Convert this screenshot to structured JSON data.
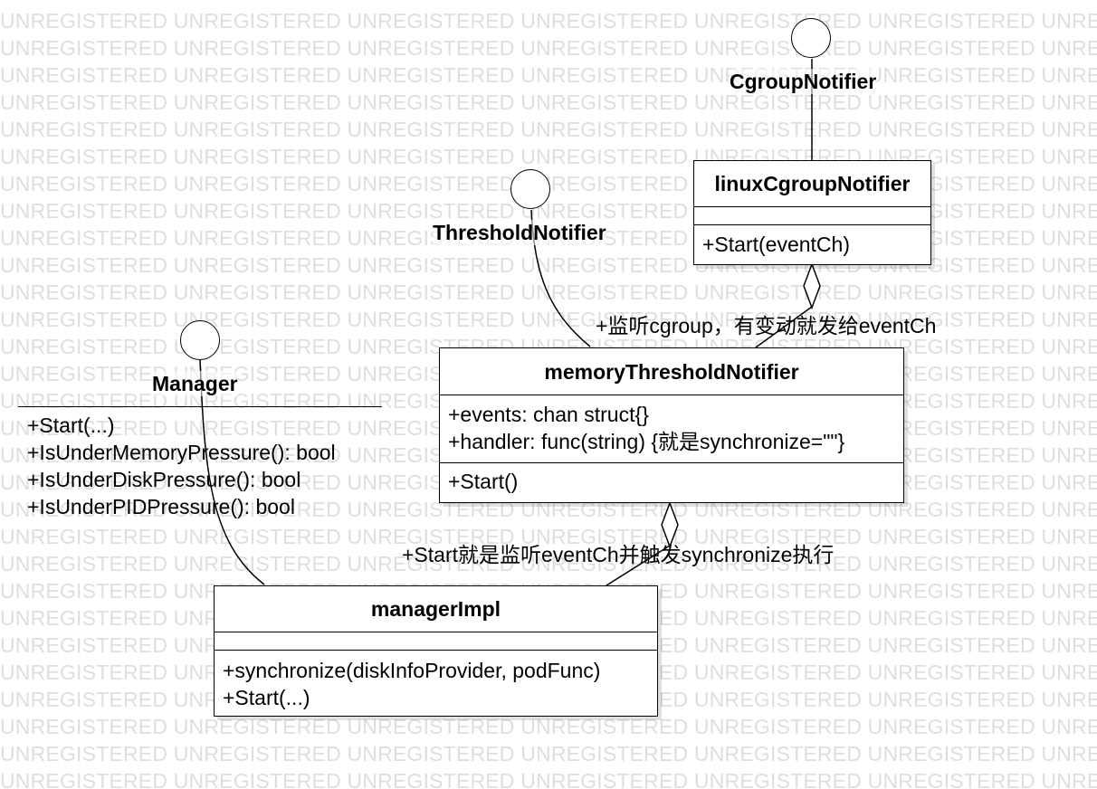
{
  "watermark": {
    "text": "UNREGISTERED",
    "rows": 29
  },
  "interfaces": {
    "manager": {
      "name": "Manager",
      "operations": [
        "+Start(...)",
        "+IsUnderMemoryPressure(): bool",
        "+IsUnderDiskPressure(): bool",
        "+IsUnderPIDPressure(): bool"
      ]
    },
    "threshold_notifier": {
      "name": "ThresholdNotifier"
    },
    "cgroup_notifier": {
      "name": "CgroupNotifier"
    }
  },
  "classes": {
    "linux_cgroup_notifier": {
      "name": "linuxCgroupNotifier",
      "attributes": [],
      "operations": [
        "+Start(eventCh)"
      ]
    },
    "memory_threshold_notifier": {
      "name": "memoryThresholdNotifier",
      "attributes": [
        "+events: chan struct{}",
        "+handler: func(string) {就是synchronize=\"\"}"
      ],
      "operations": [
        "+Start()"
      ]
    },
    "manager_impl": {
      "name": "managerImpl",
      "attributes": [],
      "operations": [
        "+synchronize(diskInfoProvider, podFunc)",
        "+Start(...)"
      ]
    }
  },
  "associations": {
    "cgroup_to_threshold": "+监听cgroup，有变动就发给eventCh",
    "threshold_to_manager": "+Start就是监听eventCh并触发synchronize执行"
  },
  "colors": {
    "line": "#000000",
    "watermark": "#dedede",
    "background": "#ffffff"
  }
}
